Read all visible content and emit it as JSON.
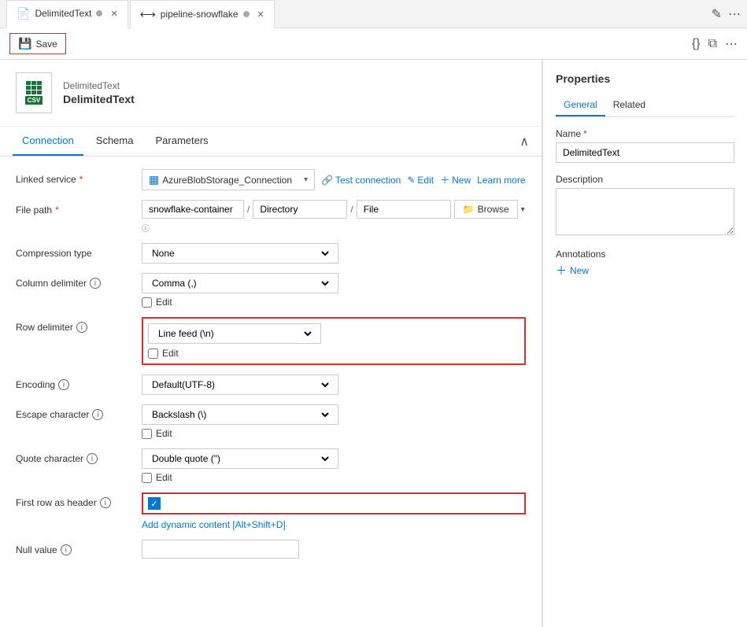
{
  "tabs": [
    {
      "id": "delimited",
      "label": "DelimitedText",
      "icon": "file",
      "active": true,
      "has_dot": true
    },
    {
      "id": "pipeline",
      "label": "pipeline-snowflake",
      "icon": "pipeline",
      "active": false,
      "has_dot": true
    }
  ],
  "toolbar": {
    "save_label": "Save",
    "icons": [
      "edit-pencil",
      "code-braces",
      "copy",
      "more-actions"
    ]
  },
  "dataset": {
    "type": "DelimitedText",
    "name": "DelimitedText"
  },
  "content_tabs": [
    {
      "id": "connection",
      "label": "Connection",
      "active": true
    },
    {
      "id": "schema",
      "label": "Schema",
      "active": false
    },
    {
      "id": "parameters",
      "label": "Parameters",
      "active": false
    }
  ],
  "form": {
    "linked_service": {
      "label": "Linked service",
      "required": true,
      "value": "AzureBlobStorage_Connection",
      "actions": [
        "Test connection",
        "Edit",
        "New",
        "Learn more"
      ]
    },
    "file_path": {
      "label": "File path",
      "required": true,
      "container": "snowflake-container",
      "directory": "Directory",
      "file": "File"
    },
    "compression_type": {
      "label": "Compression type",
      "value": "None"
    },
    "column_delimiter": {
      "label": "Column delimiter",
      "info": true,
      "value": "Comma (,)",
      "edit_label": "Edit"
    },
    "row_delimiter": {
      "label": "Row delimiter",
      "info": true,
      "value": "Line feed (\\n)",
      "edit_label": "Edit",
      "highlighted": true
    },
    "encoding": {
      "label": "Encoding",
      "info": true,
      "value": "Default(UTF-8)"
    },
    "escape_character": {
      "label": "Escape character",
      "info": true,
      "value": "Backslash (\\)",
      "edit_label": "Edit"
    },
    "quote_character": {
      "label": "Quote character",
      "info": true,
      "value": "Double quote (\")",
      "edit_label": "Edit"
    },
    "first_row_as_header": {
      "label": "First row as header",
      "info": true,
      "checked": true,
      "highlighted": true,
      "dynamic_content": "Add dynamic content [Alt+Shift+D]"
    },
    "null_value": {
      "label": "Null value",
      "info": true,
      "value": ""
    }
  },
  "properties": {
    "title": "Properties",
    "tabs": [
      {
        "id": "general",
        "label": "General",
        "active": true
      },
      {
        "id": "related",
        "label": "Related",
        "active": false
      }
    ],
    "name_label": "Name",
    "name_required": true,
    "name_value": "DelimitedText",
    "description_label": "Description",
    "description_value": "",
    "annotations_label": "Annotations",
    "add_annotation_label": "New"
  }
}
